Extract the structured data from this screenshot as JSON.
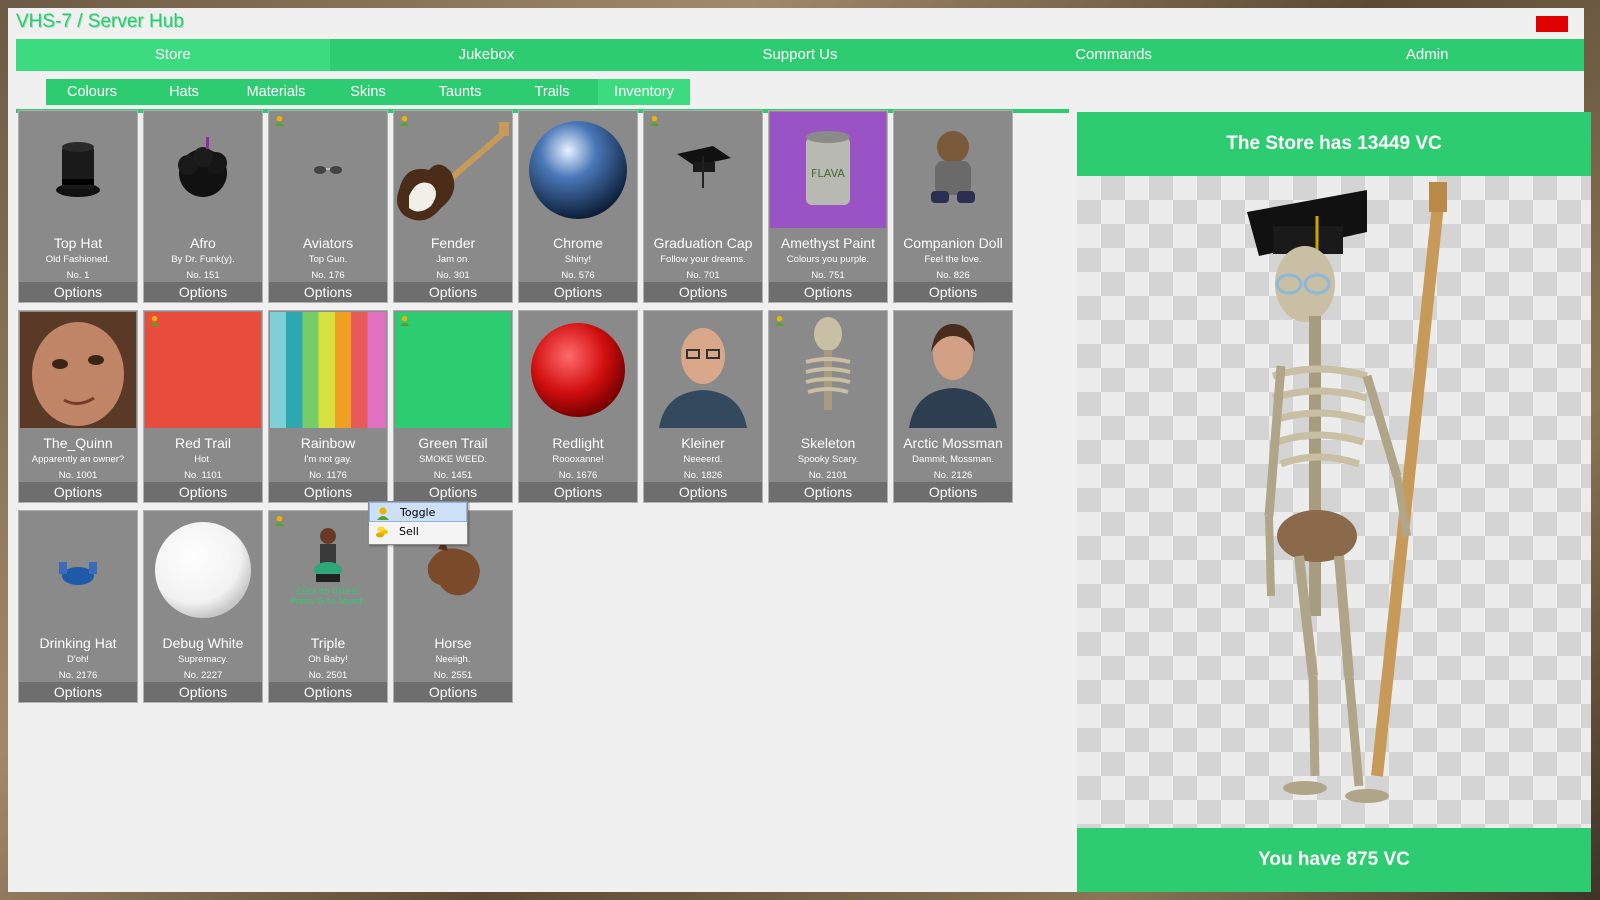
{
  "window": {
    "title": "VHS-7 / Server Hub"
  },
  "main_tabs": [
    {
      "label": "Store"
    },
    {
      "label": "Jukebox"
    },
    {
      "label": "Support Us"
    },
    {
      "label": "Commands"
    },
    {
      "label": "Admin"
    }
  ],
  "sub_tabs": [
    {
      "label": "Colours"
    },
    {
      "label": "Hats"
    },
    {
      "label": "Materials"
    },
    {
      "label": "Skins"
    },
    {
      "label": "Taunts"
    },
    {
      "label": "Trails"
    },
    {
      "label": "Inventory"
    }
  ],
  "items": [
    {
      "name": "Top Hat",
      "desc": "Old Fashioned.",
      "num": "No. 1",
      "options": "Options"
    },
    {
      "name": "Afro",
      "desc": "By Dr. Funk(y).",
      "num": "No. 151",
      "options": "Options"
    },
    {
      "name": "Aviators",
      "desc": "Top Gun.",
      "num": "No. 176",
      "options": "Options"
    },
    {
      "name": "Fender",
      "desc": "Jam on.",
      "num": "No. 301",
      "options": "Options"
    },
    {
      "name": "Chrome",
      "desc": "Shiny!",
      "num": "No. 576",
      "options": "Options"
    },
    {
      "name": "Graduation Cap",
      "desc": "Follow your dreams.",
      "num": "No. 701",
      "options": "Options"
    },
    {
      "name": "Amethyst Paint",
      "desc": "Colours you purple.",
      "num": "No. 751",
      "options": "Options"
    },
    {
      "name": "Companion Doll",
      "desc": "Feel the love.",
      "num": "No. 826",
      "options": "Options"
    },
    {
      "name": "The_Quinn",
      "desc": "Apparently an owner?",
      "num": "No. 1001",
      "options": "Options"
    },
    {
      "name": "Red Trail",
      "desc": "Hot.",
      "num": "No. 1101",
      "options": "Options"
    },
    {
      "name": "Rainbow",
      "desc": "I'm not gay.",
      "num": "No. 1176",
      "options": "Options"
    },
    {
      "name": "Green Trail",
      "desc": "SMOKE WEED.",
      "num": "No. 1451",
      "options": "Options"
    },
    {
      "name": "Redlight",
      "desc": "Roooxanne!",
      "num": "No. 1676",
      "options": "Options"
    },
    {
      "name": "Kleiner",
      "desc": "Neeeerd.",
      "num": "No. 1826",
      "options": "Options"
    },
    {
      "name": "Skeleton",
      "desc": "Spooky Scary.",
      "num": "No. 2101",
      "options": "Options"
    },
    {
      "name": "Arctic Mossman",
      "desc": "Dammit, Mossman.",
      "num": "No. 2126",
      "options": "Options"
    },
    {
      "name": "Drinking Hat",
      "desc": "D'oh!",
      "num": "No. 2176",
      "options": "Options"
    },
    {
      "name": "Debug White",
      "desc": "Supremacy.",
      "num": "No. 2227",
      "options": "Options"
    },
    {
      "name": "Triple",
      "desc": "Oh Baby!",
      "num": "No. 2501",
      "options": "Options"
    },
    {
      "name": "Horse",
      "desc": "Neeiigh.",
      "num": "No. 2551",
      "options": "Options"
    }
  ],
  "triple_overlay": {
    "line1": "Click to listen.",
    "line2": "Press G to taunt."
  },
  "paint_label": "FLAVA",
  "context_menu": {
    "toggle": "Toggle",
    "sell": "Sell"
  },
  "store_balance": "The Store has 13449 VC",
  "user_balance": "You have 875 VC",
  "colors": {
    "accent": "#2ecc71",
    "close": "#e00000",
    "card": "#8a8a8a"
  }
}
